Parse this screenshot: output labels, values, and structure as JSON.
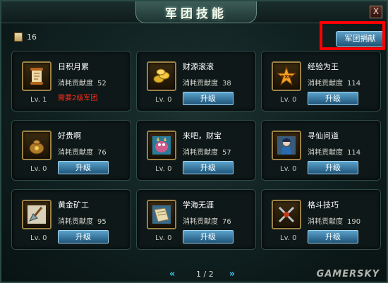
{
  "window": {
    "title": "军团技能",
    "close_label": "X"
  },
  "header": {
    "points_value": "16",
    "donate_label": "军团捐献"
  },
  "skills": [
    {
      "name": "日积月累",
      "cost_label": "消耗贡献度",
      "cost": "52",
      "level": "Lv. 1",
      "requirement": "需要2级军团",
      "icon": "scroll-icon"
    },
    {
      "name": "财源滚滚",
      "cost_label": "消耗贡献度",
      "cost": "38",
      "level": "Lv. 0",
      "upgrade_label": "升级",
      "icon": "gold-coins-icon"
    },
    {
      "name": "经验为王",
      "cost_label": "消耗贡献度",
      "cost": "114",
      "level": "Lv. 0",
      "upgrade_label": "升级",
      "icon": "exp-icon"
    },
    {
      "name": "好贵啊",
      "cost_label": "消耗贡献度",
      "cost": "76",
      "level": "Lv. 0",
      "upgrade_label": "升级",
      "icon": "money-bag-icon"
    },
    {
      "name": "来吧，财宝",
      "cost_label": "消耗贡献度",
      "cost": "57",
      "level": "Lv. 0",
      "upgrade_label": "升级",
      "icon": "treasure-beast-icon"
    },
    {
      "name": "寻仙问道",
      "cost_label": "消耗贡献度",
      "cost": "114",
      "level": "Lv. 0",
      "upgrade_label": "升级",
      "icon": "immortal-icon"
    },
    {
      "name": "黄金矿工",
      "cost_label": "消耗贡献度",
      "cost": "95",
      "level": "Lv. 0",
      "upgrade_label": "升级",
      "icon": "shovel-icon"
    },
    {
      "name": "学海无涯",
      "cost_label": "消耗贡献度",
      "cost": "76",
      "level": "Lv. 0",
      "upgrade_label": "升级",
      "icon": "book-scroll-icon"
    },
    {
      "name": "格斗技巧",
      "cost_label": "消耗贡献度",
      "cost": "190",
      "level": "Lv. 0",
      "upgrade_label": "升级",
      "icon": "crossed-weapons-icon"
    }
  ],
  "pager": {
    "page": "1 / 2",
    "prev_glyph": "«",
    "next_glyph": "»"
  },
  "watermark": "GAMERSKY",
  "colors": {
    "accent_button": "#2f6e96",
    "warning_text": "#ff2a1a",
    "highlight_box": "#ff0000"
  }
}
